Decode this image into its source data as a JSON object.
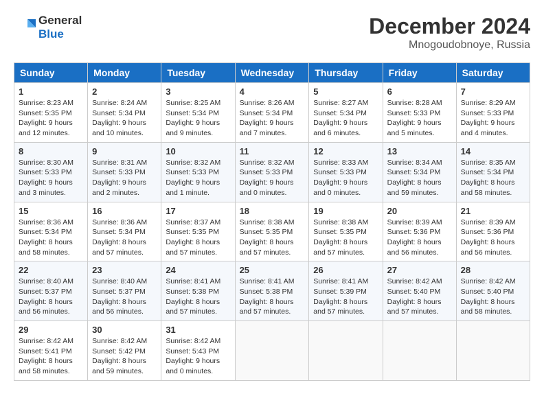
{
  "logo": {
    "text_general": "General",
    "text_blue": "Blue"
  },
  "title": "December 2024",
  "subtitle": "Mnogoudobnoye, Russia",
  "weekdays": [
    "Sunday",
    "Monday",
    "Tuesday",
    "Wednesday",
    "Thursday",
    "Friday",
    "Saturday"
  ],
  "weeks": [
    [
      {
        "day": "1",
        "info": "Sunrise: 8:23 AM\nSunset: 5:35 PM\nDaylight: 9 hours\nand 12 minutes."
      },
      {
        "day": "2",
        "info": "Sunrise: 8:24 AM\nSunset: 5:34 PM\nDaylight: 9 hours\nand 10 minutes."
      },
      {
        "day": "3",
        "info": "Sunrise: 8:25 AM\nSunset: 5:34 PM\nDaylight: 9 hours\nand 9 minutes."
      },
      {
        "day": "4",
        "info": "Sunrise: 8:26 AM\nSunset: 5:34 PM\nDaylight: 9 hours\nand 7 minutes."
      },
      {
        "day": "5",
        "info": "Sunrise: 8:27 AM\nSunset: 5:34 PM\nDaylight: 9 hours\nand 6 minutes."
      },
      {
        "day": "6",
        "info": "Sunrise: 8:28 AM\nSunset: 5:33 PM\nDaylight: 9 hours\nand 5 minutes."
      },
      {
        "day": "7",
        "info": "Sunrise: 8:29 AM\nSunset: 5:33 PM\nDaylight: 9 hours\nand 4 minutes."
      }
    ],
    [
      {
        "day": "8",
        "info": "Sunrise: 8:30 AM\nSunset: 5:33 PM\nDaylight: 9 hours\nand 3 minutes."
      },
      {
        "day": "9",
        "info": "Sunrise: 8:31 AM\nSunset: 5:33 PM\nDaylight: 9 hours\nand 2 minutes."
      },
      {
        "day": "10",
        "info": "Sunrise: 8:32 AM\nSunset: 5:33 PM\nDaylight: 9 hours\nand 1 minute."
      },
      {
        "day": "11",
        "info": "Sunrise: 8:32 AM\nSunset: 5:33 PM\nDaylight: 9 hours\nand 0 minutes."
      },
      {
        "day": "12",
        "info": "Sunrise: 8:33 AM\nSunset: 5:33 PM\nDaylight: 9 hours\nand 0 minutes."
      },
      {
        "day": "13",
        "info": "Sunrise: 8:34 AM\nSunset: 5:34 PM\nDaylight: 8 hours\nand 59 minutes."
      },
      {
        "day": "14",
        "info": "Sunrise: 8:35 AM\nSunset: 5:34 PM\nDaylight: 8 hours\nand 58 minutes."
      }
    ],
    [
      {
        "day": "15",
        "info": "Sunrise: 8:36 AM\nSunset: 5:34 PM\nDaylight: 8 hours\nand 58 minutes."
      },
      {
        "day": "16",
        "info": "Sunrise: 8:36 AM\nSunset: 5:34 PM\nDaylight: 8 hours\nand 57 minutes."
      },
      {
        "day": "17",
        "info": "Sunrise: 8:37 AM\nSunset: 5:35 PM\nDaylight: 8 hours\nand 57 minutes."
      },
      {
        "day": "18",
        "info": "Sunrise: 8:38 AM\nSunset: 5:35 PM\nDaylight: 8 hours\nand 57 minutes."
      },
      {
        "day": "19",
        "info": "Sunrise: 8:38 AM\nSunset: 5:35 PM\nDaylight: 8 hours\nand 57 minutes."
      },
      {
        "day": "20",
        "info": "Sunrise: 8:39 AM\nSunset: 5:36 PM\nDaylight: 8 hours\nand 56 minutes."
      },
      {
        "day": "21",
        "info": "Sunrise: 8:39 AM\nSunset: 5:36 PM\nDaylight: 8 hours\nand 56 minutes."
      }
    ],
    [
      {
        "day": "22",
        "info": "Sunrise: 8:40 AM\nSunset: 5:37 PM\nDaylight: 8 hours\nand 56 minutes."
      },
      {
        "day": "23",
        "info": "Sunrise: 8:40 AM\nSunset: 5:37 PM\nDaylight: 8 hours\nand 56 minutes."
      },
      {
        "day": "24",
        "info": "Sunrise: 8:41 AM\nSunset: 5:38 PM\nDaylight: 8 hours\nand 57 minutes."
      },
      {
        "day": "25",
        "info": "Sunrise: 8:41 AM\nSunset: 5:38 PM\nDaylight: 8 hours\nand 57 minutes."
      },
      {
        "day": "26",
        "info": "Sunrise: 8:41 AM\nSunset: 5:39 PM\nDaylight: 8 hours\nand 57 minutes."
      },
      {
        "day": "27",
        "info": "Sunrise: 8:42 AM\nSunset: 5:40 PM\nDaylight: 8 hours\nand 57 minutes."
      },
      {
        "day": "28",
        "info": "Sunrise: 8:42 AM\nSunset: 5:40 PM\nDaylight: 8 hours\nand 58 minutes."
      }
    ],
    [
      {
        "day": "29",
        "info": "Sunrise: 8:42 AM\nSunset: 5:41 PM\nDaylight: 8 hours\nand 58 minutes."
      },
      {
        "day": "30",
        "info": "Sunrise: 8:42 AM\nSunset: 5:42 PM\nDaylight: 8 hours\nand 59 minutes."
      },
      {
        "day": "31",
        "info": "Sunrise: 8:42 AM\nSunset: 5:43 PM\nDaylight: 9 hours\nand 0 minutes."
      },
      null,
      null,
      null,
      null
    ]
  ]
}
